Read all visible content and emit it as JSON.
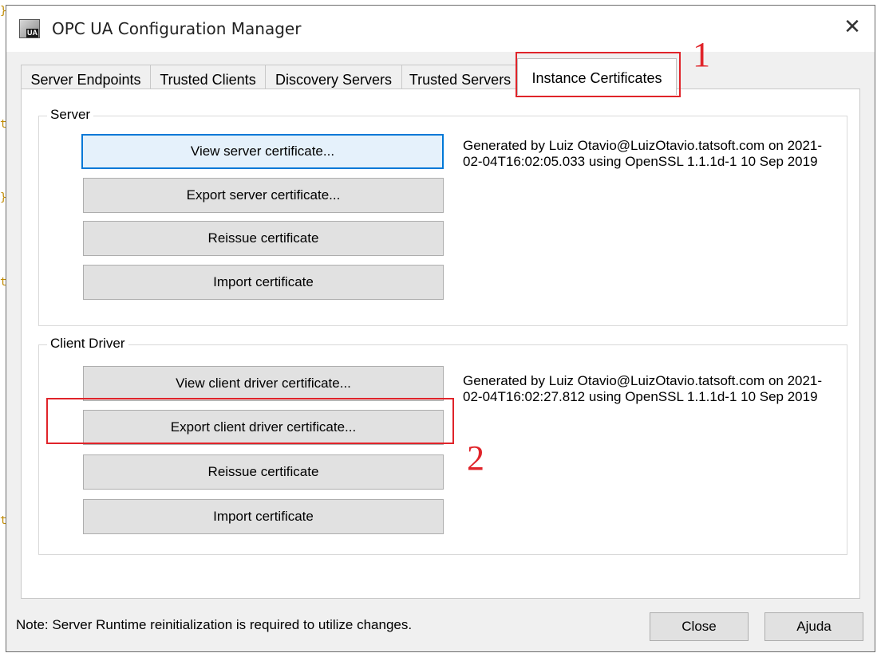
{
  "window": {
    "title": "OPC UA Configuration Manager",
    "icon_badge": "UA",
    "close_glyph": "✕"
  },
  "tabs": [
    {
      "label": "Server Endpoints"
    },
    {
      "label": "Trusted Clients"
    },
    {
      "label": "Discovery Servers"
    },
    {
      "label": "Trusted Servers"
    },
    {
      "label": "Instance Certificates",
      "active": true
    }
  ],
  "server_group": {
    "title": "Server",
    "buttons": {
      "view": "View server certificate...",
      "export": "Export server certificate...",
      "reissue": "Reissue certificate",
      "import": "Import certificate"
    },
    "info": "Generated by Luiz Otavio@LuizOtavio.tatsoft.com on 2021-02-04T16:02:05.033 using OpenSSL 1.1.1d-1  10 Sep 2019"
  },
  "client_group": {
    "title": "Client Driver",
    "buttons": {
      "view": "View client driver certificate...",
      "export": "Export client driver certificate...",
      "reissue": "Reissue certificate",
      "import": "Import certificate"
    },
    "info": "Generated by Luiz Otavio@LuizOtavio.tatsoft.com on 2021-02-04T16:02:27.812 using OpenSSL 1.1.1d-1  10 Sep 2019"
  },
  "annotations": {
    "one": "1",
    "two": "2",
    "color": "#e0242a"
  },
  "footer": {
    "note": "Note: Server Runtime reinitialization is required to utilize changes.",
    "close_label": "Close",
    "help_label": "Ajuda"
  }
}
